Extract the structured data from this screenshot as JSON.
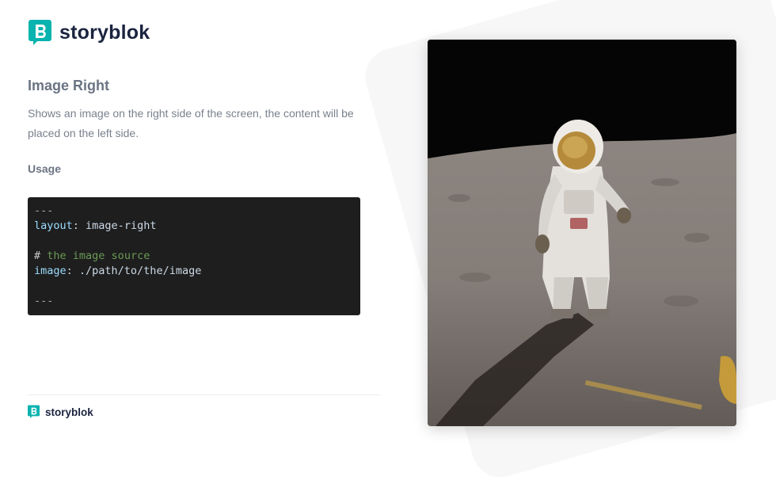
{
  "brand": {
    "name": "storyblok",
    "logo_icon": "storyblok-logo-icon",
    "accent": "#09b3af",
    "text_color": "#1b243f"
  },
  "content": {
    "title": "Image Right",
    "description": "Shows an image on the right side of the screen, the content will be placed on the left side.",
    "usage_heading": "Usage"
  },
  "code": {
    "separator_open": "---",
    "layout_key": "layout",
    "layout_value": "image-right",
    "comment_hash": "#",
    "comment_text": "the image source",
    "image_key": "image",
    "image_value": "./path/to/the/image",
    "separator_close": "---"
  },
  "footer": {
    "brand_name": "storyblok"
  },
  "image": {
    "subject": "astronaut-on-moon"
  }
}
